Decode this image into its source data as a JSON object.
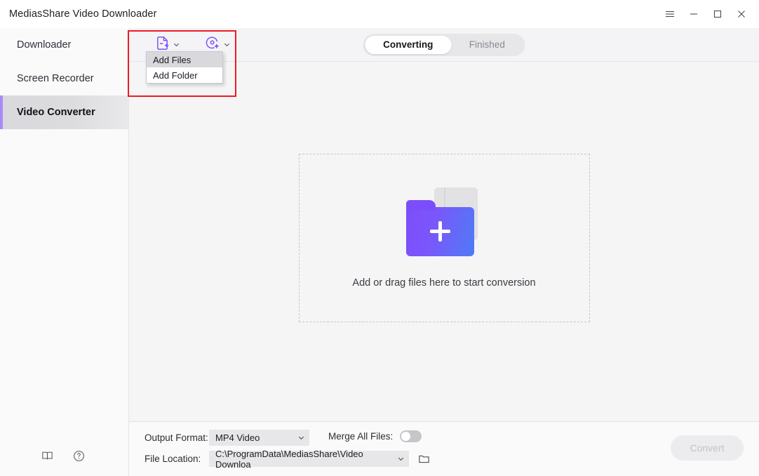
{
  "window": {
    "title": "MediasShare Video Downloader",
    "controls": [
      {
        "name": "menu-button",
        "icon": "hamburger-menu-icon"
      },
      {
        "name": "minimize-button",
        "icon": "minimize-icon"
      },
      {
        "name": "maximize-button",
        "icon": "maximize-icon"
      },
      {
        "name": "close-button",
        "icon": "close-icon"
      }
    ]
  },
  "sidebar": {
    "items": [
      {
        "label": "Downloader",
        "active": false
      },
      {
        "label": "Screen Recorder",
        "active": false
      },
      {
        "label": "Video Converter",
        "active": true
      }
    ],
    "footer_icons": [
      {
        "name": "manual-book-icon"
      },
      {
        "name": "help-question-icon"
      }
    ],
    "accent_color": "#a78bfa"
  },
  "toolbar": {
    "add_file_button": {
      "icon": "add-file-icon",
      "caret": "chevron-down-icon"
    },
    "add_disc_button": {
      "icon": "add-disc-icon",
      "caret": "chevron-down-icon"
    },
    "tabs": [
      {
        "label": "Converting",
        "active": true
      },
      {
        "label": "Finished",
        "active": false
      }
    ]
  },
  "dropdown_menu": {
    "items": [
      {
        "label": "Add Files",
        "hovered": true
      },
      {
        "label": "Add Folder",
        "hovered": false
      }
    ]
  },
  "annotation": {
    "color": "#ee1b24"
  },
  "content": {
    "dropzone_text": "Add or drag files here to start conversion",
    "folder_icon": "add-folder-gradient-icon"
  },
  "bottom": {
    "output_format_label": "Output Format:",
    "output_format_value": "MP4 Video",
    "merge_label": "Merge All Files:",
    "merge_enabled": false,
    "file_location_label": "File Location:",
    "file_location_value": "C:\\ProgramData\\MediasShare\\Video Downloa",
    "browse_icon": "folder-browse-icon",
    "convert_label": "Convert",
    "convert_enabled": false
  }
}
